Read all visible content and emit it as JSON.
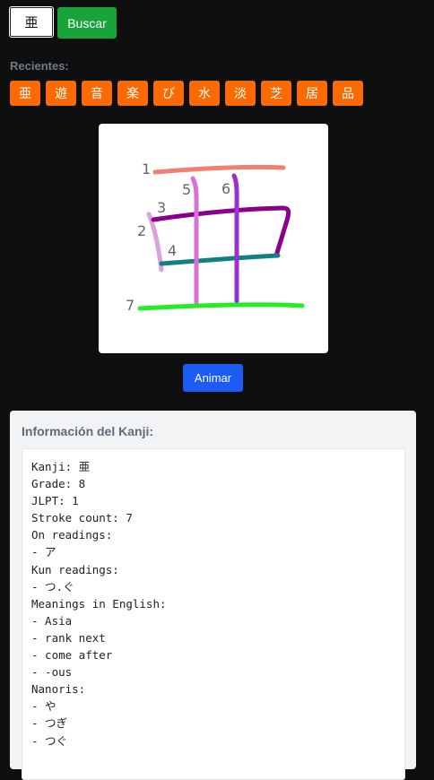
{
  "search": {
    "value": "亜",
    "button_label": "Buscar"
  },
  "recent": {
    "label": "Recientes:",
    "items": [
      "亜",
      "遊",
      "音",
      "楽",
      "び",
      "水",
      "淡",
      "芝",
      "居",
      "品"
    ]
  },
  "stroke_diagram": {
    "stroke_numbers": [
      "1",
      "2",
      "3",
      "4",
      "5",
      "6",
      "7"
    ],
    "stroke_colors": [
      "#f08070",
      "#dda0dd",
      "#8b008b",
      "#138080",
      "#da70d6",
      "#9932cc",
      "#22ee22"
    ]
  },
  "animate": {
    "button_label": "Animar"
  },
  "info": {
    "title": "Información del Kanji:",
    "lines": [
      "Kanji: 亜",
      "Grade: 8",
      "JLPT: 1",
      "Stroke count: 7",
      "On readings:",
      "- ア",
      "Kun readings:",
      "- つ.ぐ",
      "Meanings in English:",
      "- Asia",
      "- rank next",
      "- come after",
      "- -ous",
      "Nanoris:",
      "- や",
      "- つぎ",
      "- つぐ"
    ]
  }
}
